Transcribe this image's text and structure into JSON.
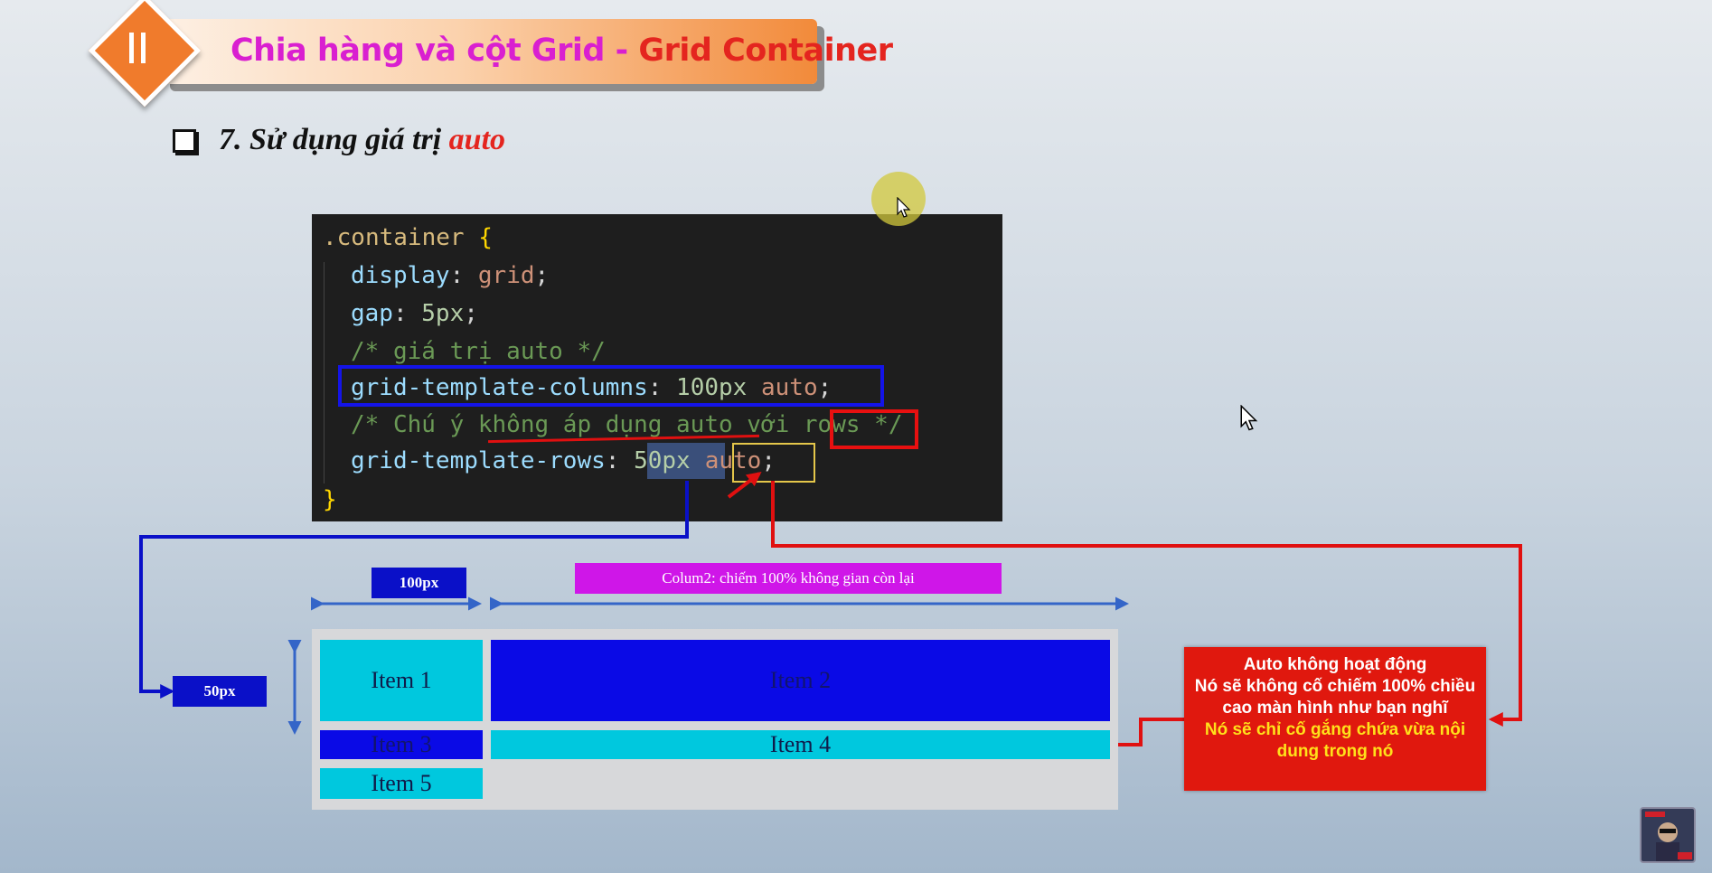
{
  "header": {
    "title_main": "Chia hàng và cột Grid - ",
    "title_accent": "Grid Container",
    "badge_icon": "pause-icon"
  },
  "subtitle": {
    "checkbox_icon": "checkbox-icon",
    "text": "7. Sử dụng giá trị ",
    "accent": "auto"
  },
  "code": {
    "line1": {
      "selector": ".container",
      "brace": " {"
    },
    "line2": {
      "prop": "display",
      "colon": ": ",
      "value": "grid",
      "semi": ";"
    },
    "line3": {
      "prop": "gap",
      "colon": ": ",
      "value": "5px",
      "semi": ";"
    },
    "line4": "/* giá trị auto */",
    "line5": {
      "prop": "grid-template-columns",
      "colon": ": ",
      "num": "100px",
      "space": " ",
      "value": "auto",
      "semi": ";"
    },
    "line6": {
      "comment_before": "/* Chú ý không áp dụng auto với ",
      "comment_word": "rows",
      "comment_after": " */"
    },
    "line7": {
      "prop": "grid-template-rows",
      "colon": ": ",
      "num": "50px",
      "value": "auto",
      "semi": ";"
    },
    "line8": "}"
  },
  "annotations": {
    "width_100": "100px",
    "column2_note": "Colum2: chiếm 100% không gian còn lại",
    "height_50": "50px"
  },
  "grid_items": [
    "Item 1",
    "Item 2",
    "Item 3",
    "Item 4",
    "Item 5"
  ],
  "note": {
    "line1": "Auto không hoạt động",
    "line2": "Nó sẽ không cố chiếm 100% chiều cao màn hình như bạn nghĩ",
    "line3": "Nó sẽ chỉ cố gắng chứa vừa nội dung trong nó"
  },
  "colors": {
    "title_magenta": "#d91fd0",
    "accent_red": "#e4251f",
    "orange": "#f07b2c",
    "grid_cyan": "#00c8de",
    "grid_blue": "#0a0ae6",
    "note_red": "#e0180e",
    "note_yellow": "#ffe11a"
  }
}
